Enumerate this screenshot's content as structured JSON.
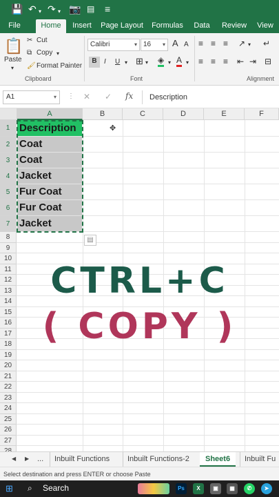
{
  "colors": {
    "excel_green": "#217346",
    "select_green": "#21c064",
    "overlay_dark": "#1c5b4a",
    "overlay_red": "#b0365a"
  },
  "qat": {
    "icons": [
      "save-icon",
      "undo-icon",
      "redo-icon",
      "camera-icon",
      "customize-icon"
    ]
  },
  "tabs": [
    "File",
    "Home",
    "Insert",
    "Page Layout",
    "Formulas",
    "Data",
    "Review",
    "View"
  ],
  "active_tab": "Home",
  "clipboard": {
    "paste": "Paste",
    "cut": "Cut",
    "copy": "Copy",
    "format_painter": "Format Painter",
    "group": "Clipboard"
  },
  "font": {
    "name": "Calibri",
    "size": "16",
    "bold": "B",
    "italic": "I",
    "underline": "U",
    "grow": "A",
    "shrink": "A",
    "group": "Font"
  },
  "alignment": {
    "group": "Alignment"
  },
  "formula_bar": {
    "name_box": "A1",
    "fx": "fx",
    "content": "Description"
  },
  "columns": [
    "A",
    "B",
    "C",
    "D",
    "E",
    "F"
  ],
  "rows": [
    "1",
    "2",
    "3",
    "4",
    "5",
    "6",
    "7",
    "8",
    "9",
    "10",
    "11",
    "12",
    "13",
    "14",
    "15",
    "16",
    "17",
    "18",
    "19",
    "20",
    "21",
    "22",
    "23",
    "24",
    "25",
    "26",
    "27",
    "28"
  ],
  "cells_a": [
    "Description",
    "Coat",
    "Coat",
    "Jacket",
    "Fur Coat",
    "Fur Coat",
    "Jacket"
  ],
  "overlay": {
    "line1": "CTRL+C",
    "line2": "( COPY )"
  },
  "sheets": [
    "Inbuilt Functions",
    "Inbuilt Functions-2",
    "Sheet6",
    "Inbuilt Fu"
  ],
  "sheet_nav": "...",
  "active_sheet": "Sheet6",
  "status": "Select destination and press ENTER or choose Paste",
  "taskbar": {
    "search": "Search",
    "icons": [
      "windows-icon",
      "search-icon",
      "photoshop-icon",
      "excel-icon",
      "app-icon",
      "whatsapp-icon",
      "telegram-icon"
    ]
  }
}
